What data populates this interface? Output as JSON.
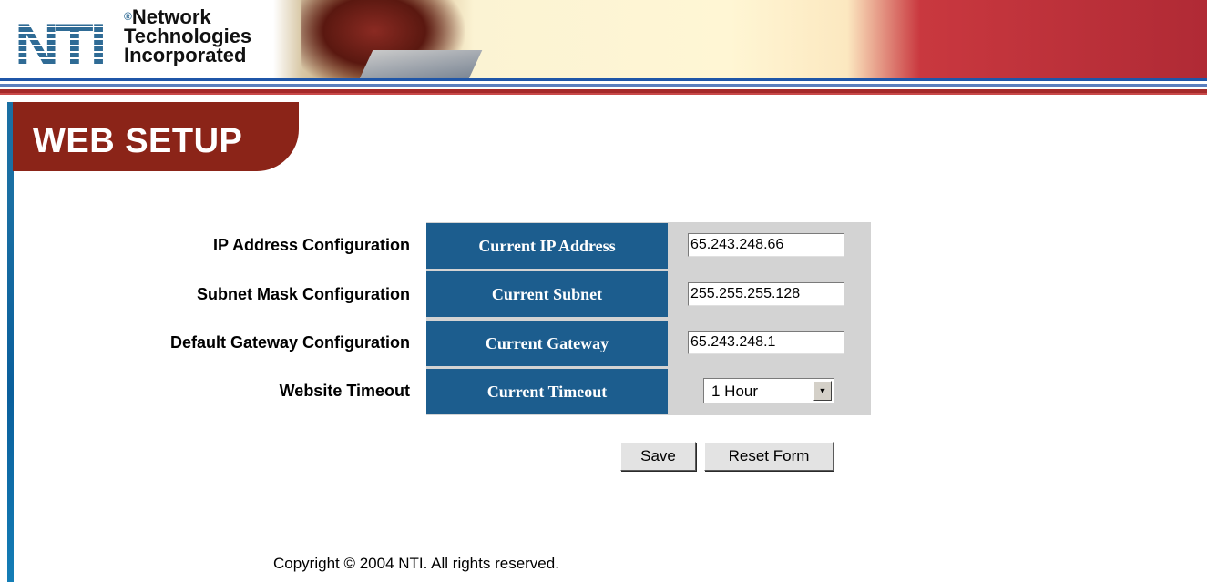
{
  "header": {
    "logo_letters": "NTI",
    "company_name_line1": "Network",
    "company_name_line2": "Technologies",
    "company_name_line3": "Incorporated",
    "registered_mark": "®"
  },
  "page": {
    "title": "WEB SETUP"
  },
  "config": {
    "rows": [
      {
        "label": "IP Address Configuration",
        "head": "Current IP Address",
        "value": "65.243.248.66"
      },
      {
        "label": "Subnet Mask Configuration",
        "head": "Current Subnet",
        "value": "255.255.255.128"
      },
      {
        "label": "Default Gateway Configuration",
        "head": "Current Gateway",
        "value": "65.243.248.1"
      },
      {
        "label": "Website Timeout",
        "head": "Current Timeout",
        "value": "1 Hour"
      }
    ]
  },
  "buttons": {
    "save_label": "Save",
    "reset_label": "Reset Form"
  },
  "footer": {
    "copyright": "Copyright © 2004 NTI. All rights reserved."
  },
  "colors": {
    "header_red": "#b02a35",
    "title_tab": "#8b2418",
    "cell_head_blue": "#1c5d8e",
    "table_gray": "#d3d3d3",
    "left_bar_blue": "#1a6fa3"
  }
}
